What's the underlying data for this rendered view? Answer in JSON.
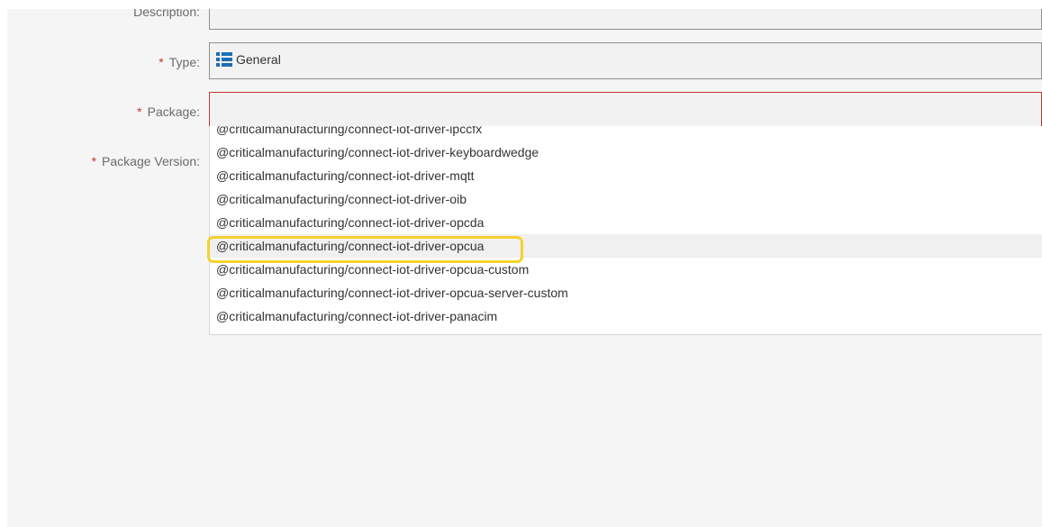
{
  "form": {
    "description_label": "Description:",
    "type_label": "Type:",
    "type_value": "General",
    "type_icon": "list-icon",
    "package_label": "Package:",
    "package_value": "",
    "package_version_label": "Package Version:",
    "required_marker": "*"
  },
  "dropdown": {
    "options": [
      "@criticalmanufacturing/connect-iot-driver-ipccfx",
      "@criticalmanufacturing/connect-iot-driver-keyboardwedge",
      "@criticalmanufacturing/connect-iot-driver-mqtt",
      "@criticalmanufacturing/connect-iot-driver-oib",
      "@criticalmanufacturing/connect-iot-driver-opcda",
      "@criticalmanufacturing/connect-iot-driver-opcua",
      "@criticalmanufacturing/connect-iot-driver-opcua-custom",
      "@criticalmanufacturing/connect-iot-driver-opcua-server-custom",
      "@criticalmanufacturing/connect-iot-driver-panacim"
    ],
    "selected_option": "@criticalmanufacturing/connect-iot-driver-opcua"
  },
  "colors": {
    "required": "#c0392b",
    "highlight": "#f5d22e",
    "icon": "#1a6fb5"
  }
}
